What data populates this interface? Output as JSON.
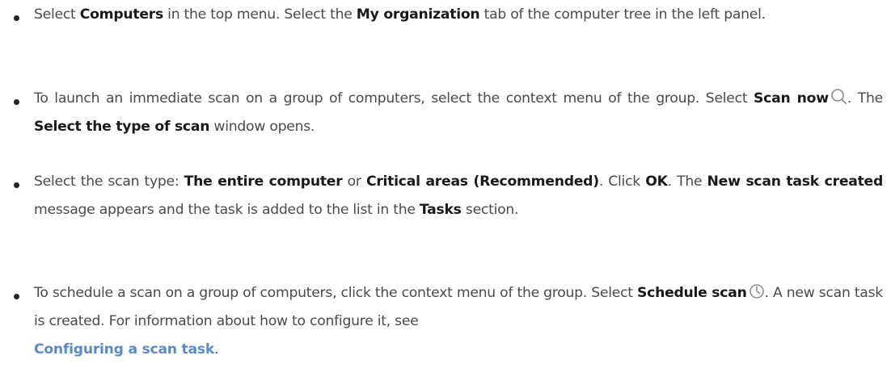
{
  "steps": [
    {
      "t1": "Select ",
      "b1": "Computers",
      "t2": " in the top menu. Select the ",
      "b2": "My organization",
      "t3": " tab of the computer tree in the left panel."
    },
    {
      "t1": "To launch an immediate scan on a group of computers, select the context menu of the group. Select ",
      "b1": "Scan now",
      "icon": "search-icon",
      "t2": ". The ",
      "b2": "Select the type of scan",
      "t3": " window opens."
    },
    {
      "t1": "Select the scan type: ",
      "b1": "The entire computer",
      "t2": " or ",
      "b2": "Critical areas (Recommended)",
      "t3": ". Click ",
      "b3": "OK",
      "t4": ". The ",
      "b4": "New scan task created",
      "t5": " message appears and the task is added to the list in the ",
      "b5": "Tasks",
      "t6": " section."
    },
    {
      "t1": "To schedule a scan on a group of computers, click the context menu of the group. Select ",
      "b1": "Schedule scan",
      "icon": "clock-icon",
      "t2": ". A new scan task is created. For information about how to configure it, see",
      "link": "Configuring a scan task",
      "t3": "."
    }
  ],
  "colors": {
    "body_text": "#4a4a4a",
    "bold_text": "#1a1a1a",
    "link": "#5b8bc6",
    "bullet": "#222222"
  }
}
